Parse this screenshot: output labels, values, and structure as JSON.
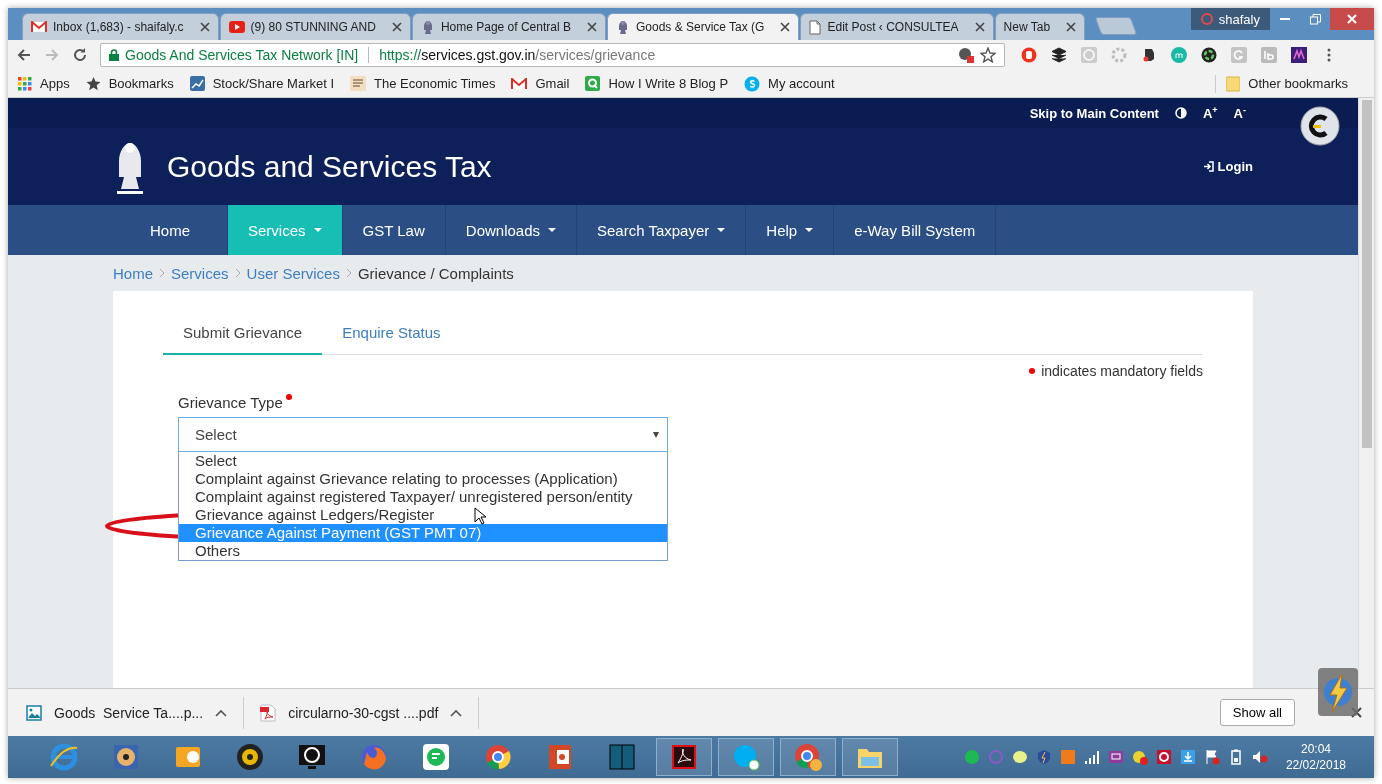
{
  "browser": {
    "tabs": [
      {
        "kind": "mail",
        "title": "Inbox (1,683) - shaifaly.c",
        "selected": false
      },
      {
        "kind": "video",
        "title": "(9) 80 STUNNING AND",
        "selected": false
      },
      {
        "kind": "emblem",
        "title": "Home Page of Central B",
        "selected": false
      },
      {
        "kind": "emblem",
        "title": "Goods & Service Tax (G",
        "selected": true
      },
      {
        "kind": "page",
        "title": "Edit Post ‹ CONSULTEA",
        "selected": false
      },
      {
        "kind": "none",
        "title": "New Tab",
        "selected": false
      }
    ],
    "profile": "shafaly",
    "address": {
      "site_name": "Goods And Services Tax Network [IN]",
      "scheme": "https://",
      "host": "services.gst.gov.in",
      "path": "/services/grievance"
    },
    "bookmarks": [
      {
        "kind": "apps",
        "label": "Apps"
      },
      {
        "kind": "star",
        "label": "Bookmarks"
      },
      {
        "kind": "chart",
        "label": "Stock/Share Market I"
      },
      {
        "kind": "news",
        "label": "The Economic Times"
      },
      {
        "kind": "mail",
        "label": "Gmail"
      },
      {
        "kind": "quora",
        "label": "How I Write 8 Blog P"
      },
      {
        "kind": "skype",
        "label": "My account"
      }
    ],
    "other_bookmarks": "Other bookmarks"
  },
  "page": {
    "skip_link": "Skip to Main Content",
    "font_larger": "A$^{+}$",
    "font_smaller": "A$^{-}$",
    "site_title": "Goods and Services Tax",
    "login": "Login",
    "nav": [
      {
        "label": "Home",
        "has_menu": false,
        "selected": false
      },
      {
        "label": "Services",
        "has_menu": true,
        "selected": true
      },
      {
        "label": "GST Law",
        "has_menu": false,
        "selected": false
      },
      {
        "label": "Downloads",
        "has_menu": true,
        "selected": false
      },
      {
        "label": "Search Taxpayer",
        "has_menu": true,
        "selected": false
      },
      {
        "label": "Help",
        "has_menu": true,
        "selected": false
      },
      {
        "label": "e-Way Bill System",
        "has_menu": false,
        "selected": false
      }
    ],
    "breadcrumb": [
      {
        "kind": "link",
        "label": "Home"
      },
      {
        "kind": "link",
        "label": "Services"
      },
      {
        "kind": "link",
        "label": "User Services"
      },
      {
        "kind": "current",
        "label": "Grievance / Complaints"
      }
    ],
    "form_tabs": [
      {
        "label": "Submit Grievance",
        "selected": true
      },
      {
        "label": "Enquire Status",
        "selected": false
      }
    ],
    "mandatory_note": "indicates mandatory fields",
    "grievance_type": {
      "label": "Grievance Type",
      "required": true,
      "value": "Select",
      "options": [
        {
          "label": "Select",
          "highlighted": false
        },
        {
          "label": "Complaint against Grievance relating to processes (Application)",
          "highlighted": false
        },
        {
          "label": "Complaint against registered Taxpayer/ unregistered person/entity",
          "highlighted": false
        },
        {
          "label": "Grievance against Ledgers/Register",
          "highlighted": false
        },
        {
          "label": "Grievance Against Payment (GST PMT 07)",
          "highlighted": true
        },
        {
          "label": "Others",
          "highlighted": false
        }
      ]
    }
  },
  "downloads": {
    "items": [
      {
        "kind": "image",
        "name": "Goods  Service Ta....p..."
      },
      {
        "kind": "pdf",
        "name": "circularno-30-cgst ....pdf"
      }
    ],
    "show_all": "Show all"
  },
  "taskbar": {
    "time": "20:04",
    "date": "22/02/2018"
  }
}
